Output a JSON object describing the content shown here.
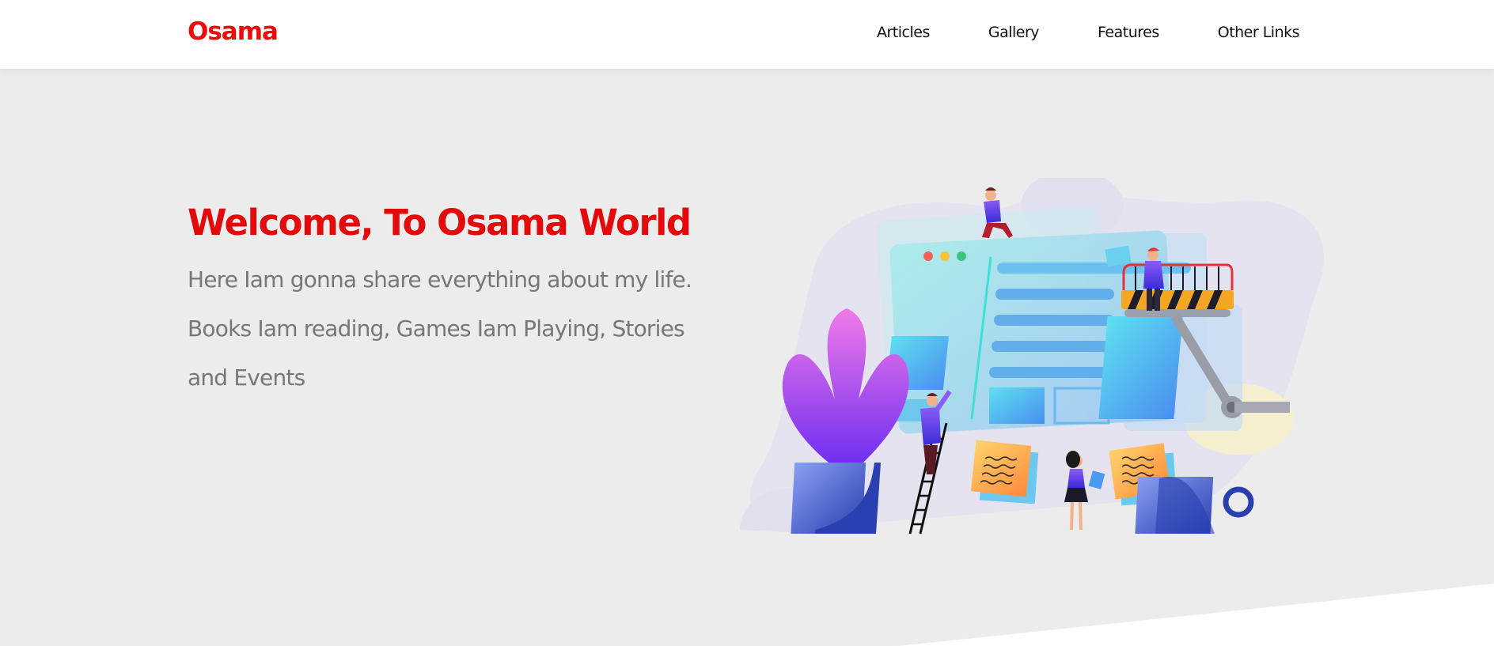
{
  "header": {
    "logo": "Osama",
    "nav": [
      "Articles",
      "Gallery",
      "Features",
      "Other Links"
    ]
  },
  "hero": {
    "title": "Welcome, To Osama World",
    "lines": [
      "Here Iam gonna share everything about my life.",
      "Books Iam reading, Games Iam Playing, Stories",
      "and Events"
    ]
  },
  "colors": {
    "brand": "#ee0a0a",
    "page_background": "#ececec",
    "header_background": "#ffffff",
    "body_text": "#777777"
  },
  "illustration": {
    "subject": "website-construction-illustration"
  }
}
